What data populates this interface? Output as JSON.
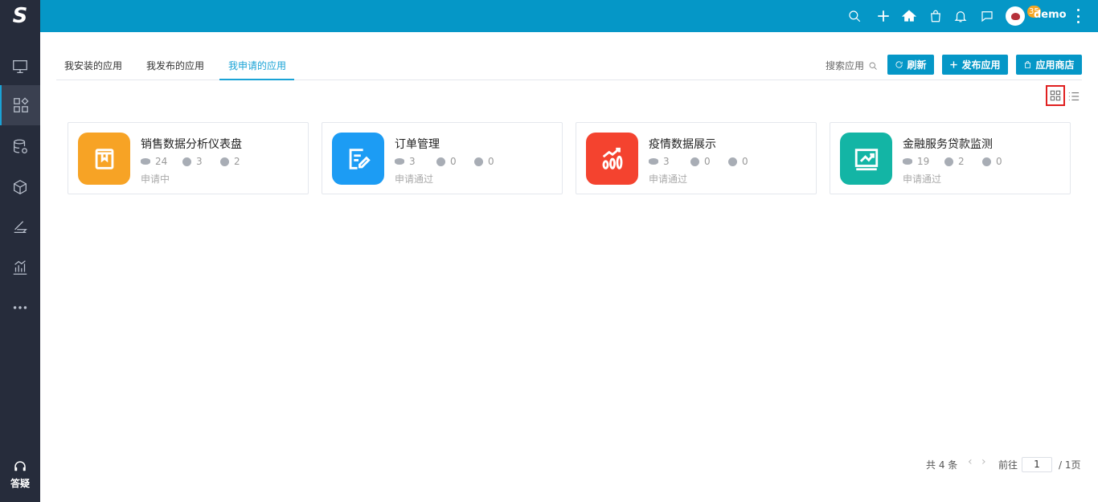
{
  "sidebar": {
    "logo": "S",
    "items": [
      {
        "icon": "monitor-icon"
      },
      {
        "icon": "apps-icon",
        "active": true
      },
      {
        "icon": "database-icon"
      },
      {
        "icon": "cube-icon"
      },
      {
        "icon": "layers-icon"
      },
      {
        "icon": "bar-chart-icon"
      },
      {
        "icon": "more-icon"
      }
    ],
    "help_label": "答疑"
  },
  "topbar": {
    "message_badge": "35",
    "username": "demo"
  },
  "tabs": [
    {
      "label": "我安装的应用"
    },
    {
      "label": "我发布的应用"
    },
    {
      "label": "我申请的应用",
      "active": true
    }
  ],
  "toolbar": {
    "search_label": "搜索应用",
    "refresh_label": "刷新",
    "publish_label": "发布应用",
    "store_label": "应用商店"
  },
  "cards": [
    {
      "title": "销售数据分析仪表盘",
      "views": "24",
      "downloads": "3",
      "comments": "2",
      "status": "申请中",
      "color": "#f7a325",
      "icon": "book-icon"
    },
    {
      "title": "订单管理",
      "views": "3",
      "downloads": "0",
      "comments": "0",
      "status": "申请通过",
      "color": "#1c9cf4",
      "icon": "edit-note-icon"
    },
    {
      "title": "疫情数据展示",
      "views": "3",
      "downloads": "0",
      "comments": "0",
      "status": "申请通过",
      "color": "#f4432f",
      "icon": "growth-chart-icon"
    },
    {
      "title": "金融服务贷款监测",
      "views": "19",
      "downloads": "2",
      "comments": "0",
      "status": "申请通过",
      "color": "#13b5a5",
      "icon": "trend-board-icon"
    }
  ],
  "pagination": {
    "total": "共 4 条",
    "goto_label": "前往",
    "current_page": "1",
    "total_pages": "/ 1页"
  }
}
